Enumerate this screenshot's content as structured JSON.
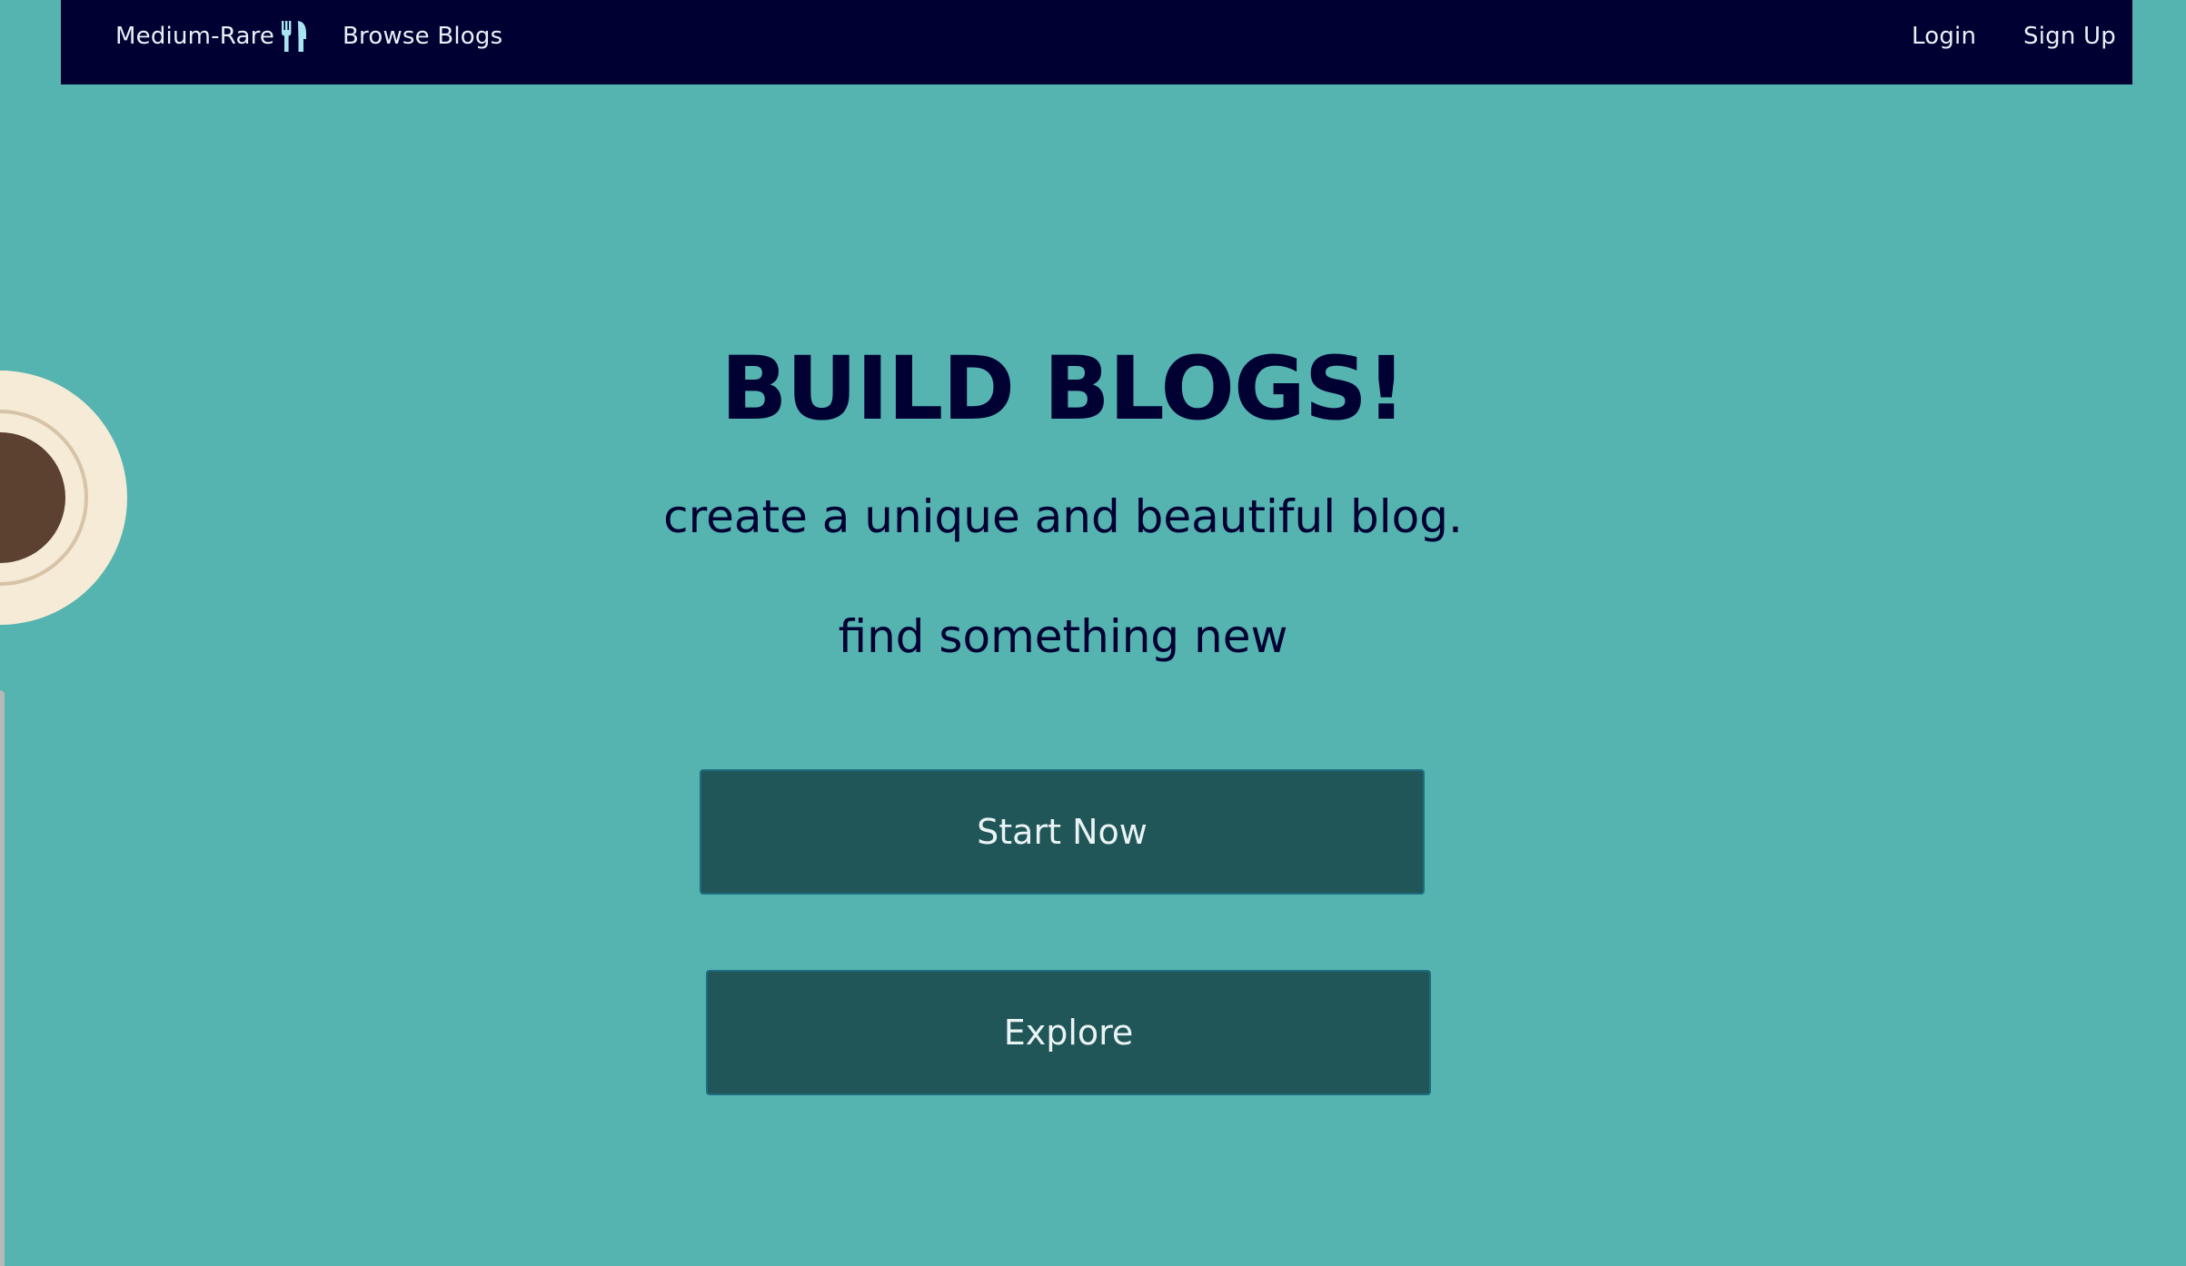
{
  "navbar": {
    "brand": "Medium-Rare",
    "brand_icon": "utensils-icon",
    "browse": "Browse Blogs",
    "login": "Login",
    "signup": "Sign Up"
  },
  "hero": {
    "title": "BUILD BLOGS!",
    "subtitle": "create a unique and beautiful blog.",
    "tagline": "find something new"
  },
  "buttons": {
    "start": "Start Now",
    "explore": "Explore"
  },
  "colors": {
    "background": "#55b3b0",
    "navbar": "#000033",
    "button": "#215659",
    "heading": "#000033",
    "brand_icon": "#a8e6ef"
  }
}
